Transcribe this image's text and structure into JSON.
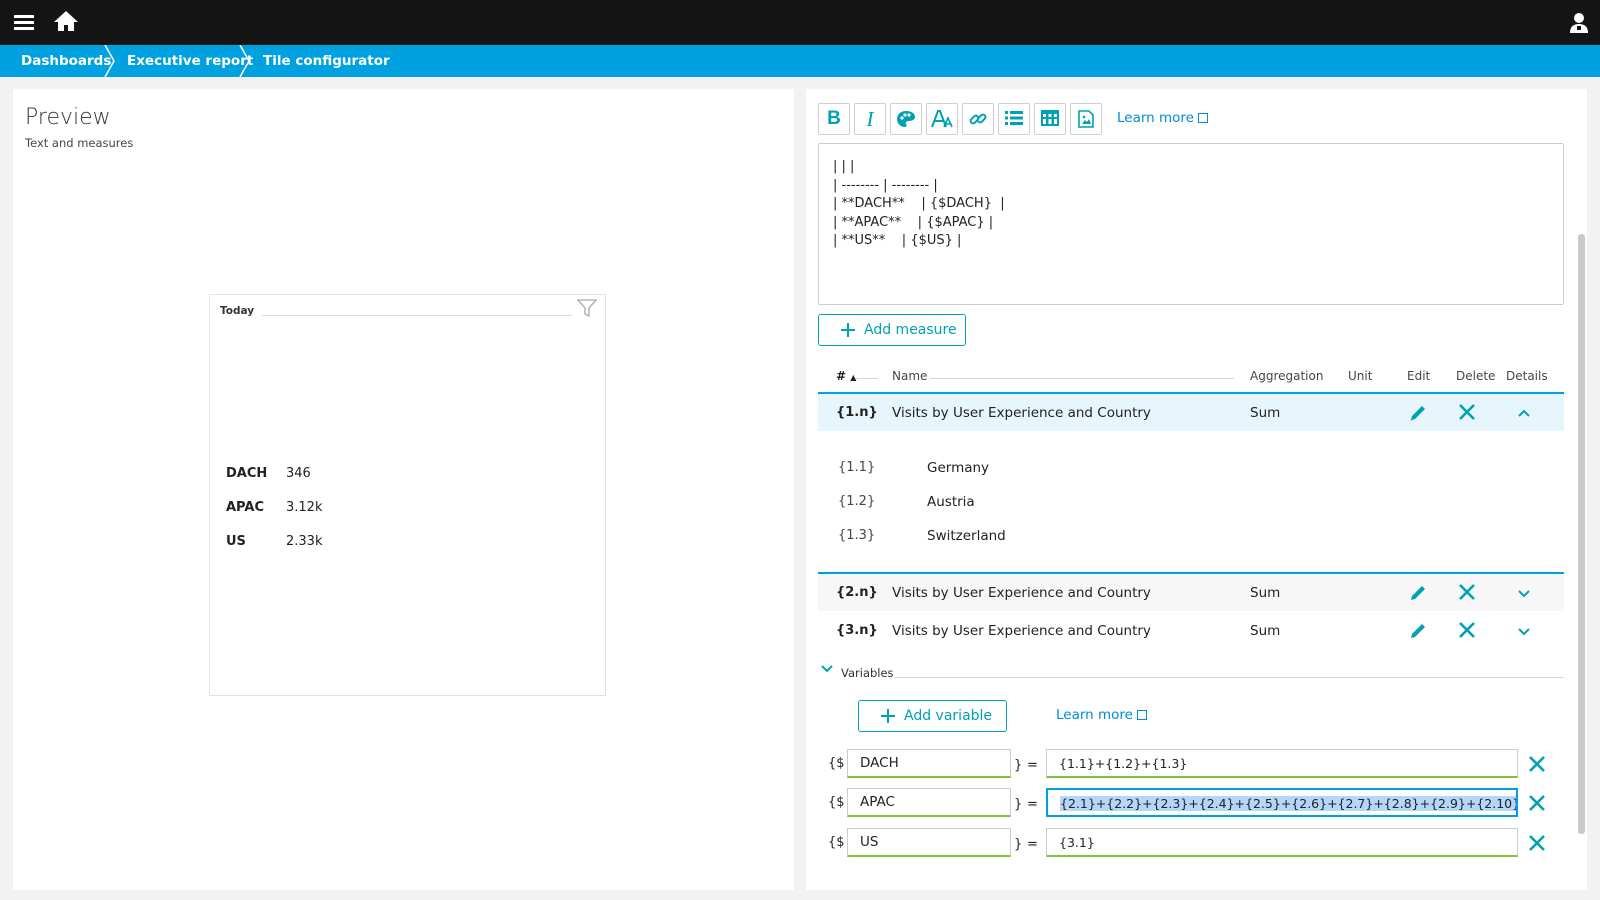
{
  "topbar": {
    "menu_icon": "hamburger-menu-icon",
    "home_icon": "home-icon",
    "user_icon": "user-icon"
  },
  "breadcrumb": [
    "Dashboards",
    "Executive report",
    "Tile configurator"
  ],
  "preview": {
    "title": "Preview",
    "subtitle": "Text and measures",
    "tile": {
      "timeframe": "Today",
      "rows": [
        {
          "label": "DACH",
          "value": "346"
        },
        {
          "label": "APAC",
          "value": "3.12k"
        },
        {
          "label": "US",
          "value": "2.33k"
        }
      ]
    }
  },
  "editor": {
    "toolbar": {
      "buttons": [
        "bold",
        "italic",
        "color",
        "font-size",
        "link",
        "list",
        "table",
        "image"
      ],
      "bold_label": "B",
      "italic_label": "I",
      "learn_more": "Learn more"
    },
    "content": "| | |\n| -------- | -------- |\n| **DACH**    | {$DACH}  |\n| **APAC**    | {$APAC} |\n| **US**    | {$US} |"
  },
  "measures": {
    "add_label": "Add measure",
    "headers": {
      "num": "#",
      "name": "Name",
      "aggregation": "Aggregation",
      "unit": "Unit",
      "edit": "Edit",
      "delete": "Delete",
      "details": "Details"
    },
    "rows": [
      {
        "id": "{1.n}",
        "name": "Visits by User Experience and Country",
        "aggregation": "Sum",
        "expanded": true
      },
      {
        "id": "{2.n}",
        "name": "Visits by User Experience and Country",
        "aggregation": "Sum",
        "expanded": false
      },
      {
        "id": "{3.n}",
        "name": "Visits by User Experience and Country",
        "aggregation": "Sum",
        "expanded": false
      }
    ],
    "subrows": [
      {
        "id": "{1.1}",
        "name": "Germany"
      },
      {
        "id": "{1.2}",
        "name": "Austria"
      },
      {
        "id": "{1.3}",
        "name": "Switzerland"
      }
    ]
  },
  "variables": {
    "label": "Variables",
    "add_label": "Add variable",
    "learn_more": "Learn more",
    "prefix": "{$",
    "suffix": "}",
    "equals": "=",
    "items": [
      {
        "name": "DACH",
        "expression": "{1.1}+{1.2}+{1.3}"
      },
      {
        "name": "APAC",
        "expression": "{2.1}+{2.2}+{2.3}+{2.4}+{2.5}+{2.6}+{2.7}+{2.8}+{2.9}+{2.10}"
      },
      {
        "name": "US",
        "expression": "{3.1}"
      }
    ]
  },
  "colors": {
    "accent": "#00a1e0",
    "teal": "#00a1b2",
    "valid": "#7dc540",
    "topbar": "#141414"
  }
}
